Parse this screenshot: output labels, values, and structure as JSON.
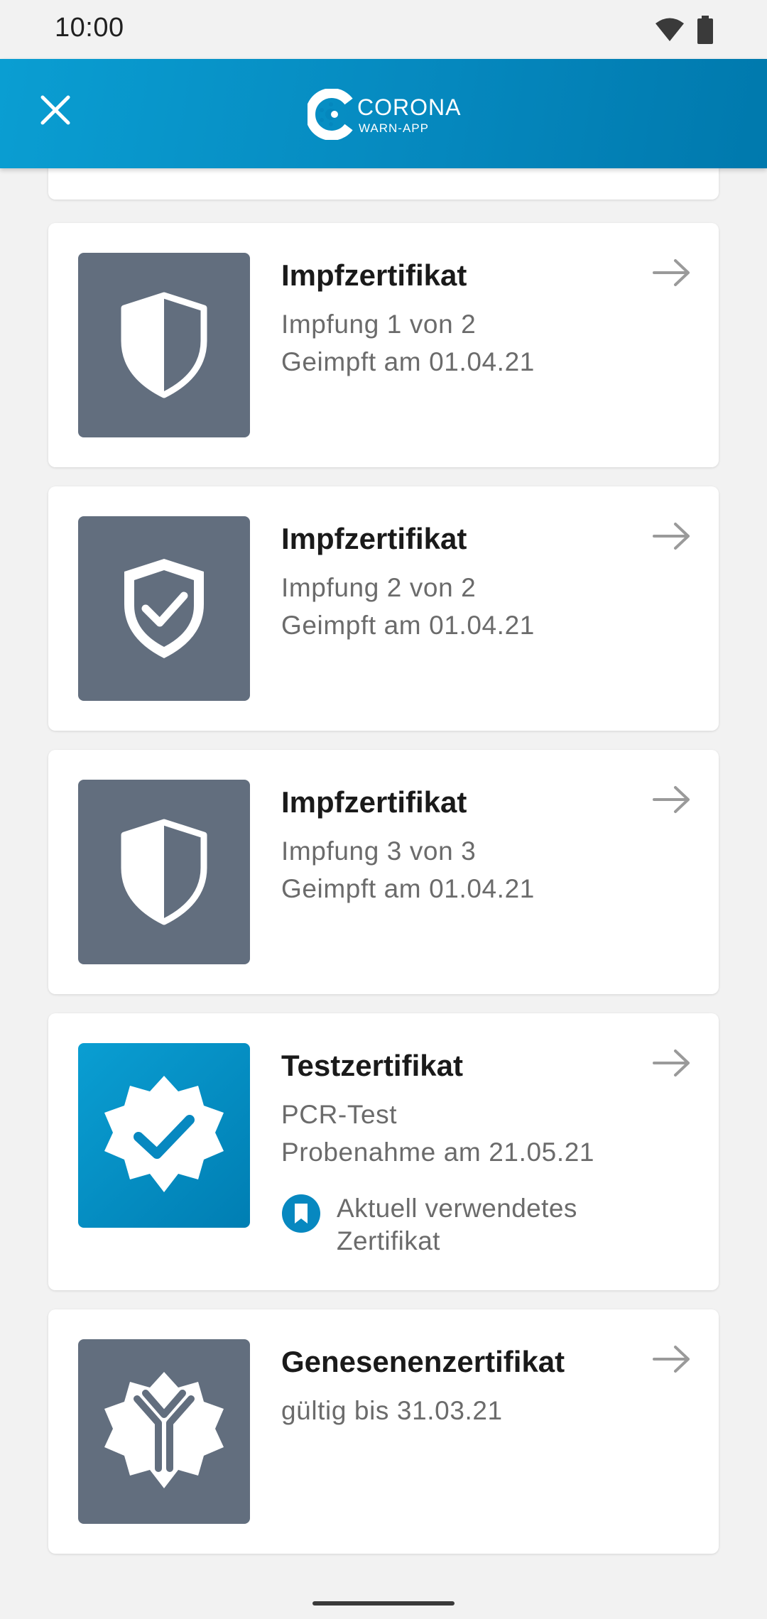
{
  "status_bar": {
    "time": "10:00"
  },
  "header": {
    "logo_title": "CORONA",
    "logo_subtitle": "WARN-APP"
  },
  "icons": {
    "close": "close-icon",
    "wifi": "wifi-icon",
    "battery": "battery-icon",
    "arrow": "arrow-right-icon",
    "shield_partial": "shield-half-icon",
    "shield_full": "shield-check-icon",
    "test": "badge-check-icon",
    "recovery": "antibody-icon",
    "bookmark": "bookmark-icon"
  },
  "colors": {
    "header": "#0587bd",
    "thumb_grey": "#626e7e",
    "thumb_blue": "#0a9ed2",
    "background": "#f2f2f2"
  },
  "certificates": [
    {
      "type": "vaccination",
      "title": "Impfzertifikat",
      "line1": "Impfung 1 von 2",
      "line2": "Geimpft am 01.04.21"
    },
    {
      "type": "vaccination-complete",
      "title": "Impfzertifikat",
      "line1": "Impfung 2 von 2",
      "line2": "Geimpft am 01.04.21"
    },
    {
      "type": "vaccination",
      "title": "Impfzertifikat",
      "line1": "Impfung 3 von 3",
      "line2": "Geimpft am 01.04.21"
    },
    {
      "type": "test",
      "title": "Testzertifikat",
      "line1": "PCR-Test",
      "line2": "Probenahme am 21.05.21",
      "badge": "Aktuell verwendetes Zertifikat"
    },
    {
      "type": "recovery",
      "title": "Genesenenzertifikat",
      "line1": "gültig bis 31.03.21"
    }
  ]
}
